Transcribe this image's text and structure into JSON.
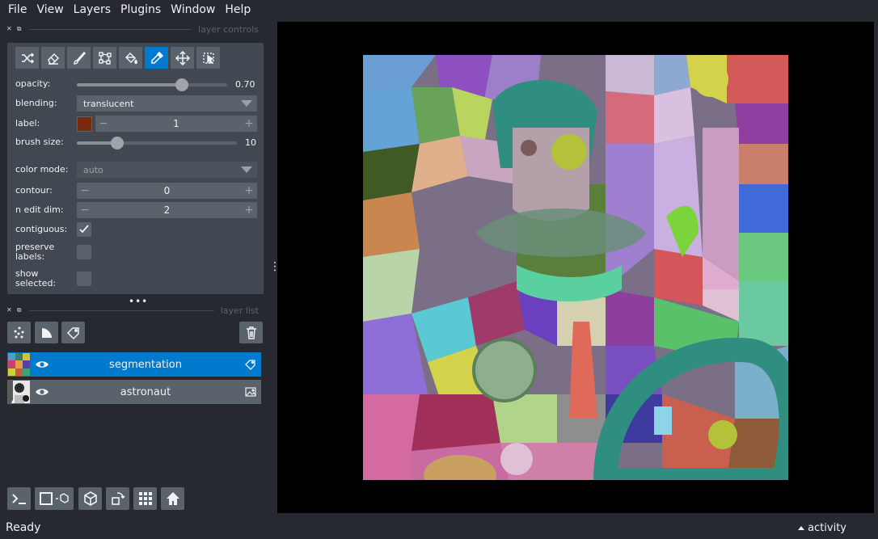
{
  "menu": [
    {
      "label": "File"
    },
    {
      "label": "View"
    },
    {
      "label": "Layers"
    },
    {
      "label": "Plugins"
    },
    {
      "label": "Window"
    },
    {
      "label": "Help"
    }
  ],
  "docks": {
    "controls_title": "layer controls",
    "list_title": "layer list"
  },
  "toolbar": {
    "tools": [
      "shuffle-colors",
      "erase",
      "paint",
      "polygon",
      "fill",
      "pick",
      "pan-zoom",
      "transform"
    ],
    "active_tool": "pick"
  },
  "controls": {
    "opacity": {
      "label": "opacity:",
      "value": 0.7,
      "display": "0.70"
    },
    "blending": {
      "label": "blending:",
      "value": "translucent"
    },
    "label": {
      "label": "label:",
      "value": "1",
      "color": "#7a2a0c"
    },
    "brush_size": {
      "label": "brush size:",
      "value": 10,
      "max": 40,
      "display": "10"
    },
    "color_mode": {
      "label": "color mode:",
      "value": "auto"
    },
    "contour": {
      "label": "contour:",
      "value": "0"
    },
    "n_edit_dim": {
      "label": "n edit dim:",
      "value": "2"
    },
    "contiguous": {
      "label": "contiguous:",
      "checked": true
    },
    "preserve_labels": {
      "label": "preserve labels:",
      "checked": false
    },
    "show_selected": {
      "label": "show selected:",
      "checked": false
    }
  },
  "layers": [
    {
      "name": "segmentation",
      "type": "labels",
      "selected": true,
      "visible": true
    },
    {
      "name": "astronaut",
      "type": "image",
      "selected": false,
      "visible": true
    }
  ],
  "status": {
    "text": "Ready",
    "activity": "activity"
  },
  "colors": {
    "background": "#262930",
    "panel": "#414851",
    "button": "#5a626c",
    "accent": "#007acc"
  }
}
